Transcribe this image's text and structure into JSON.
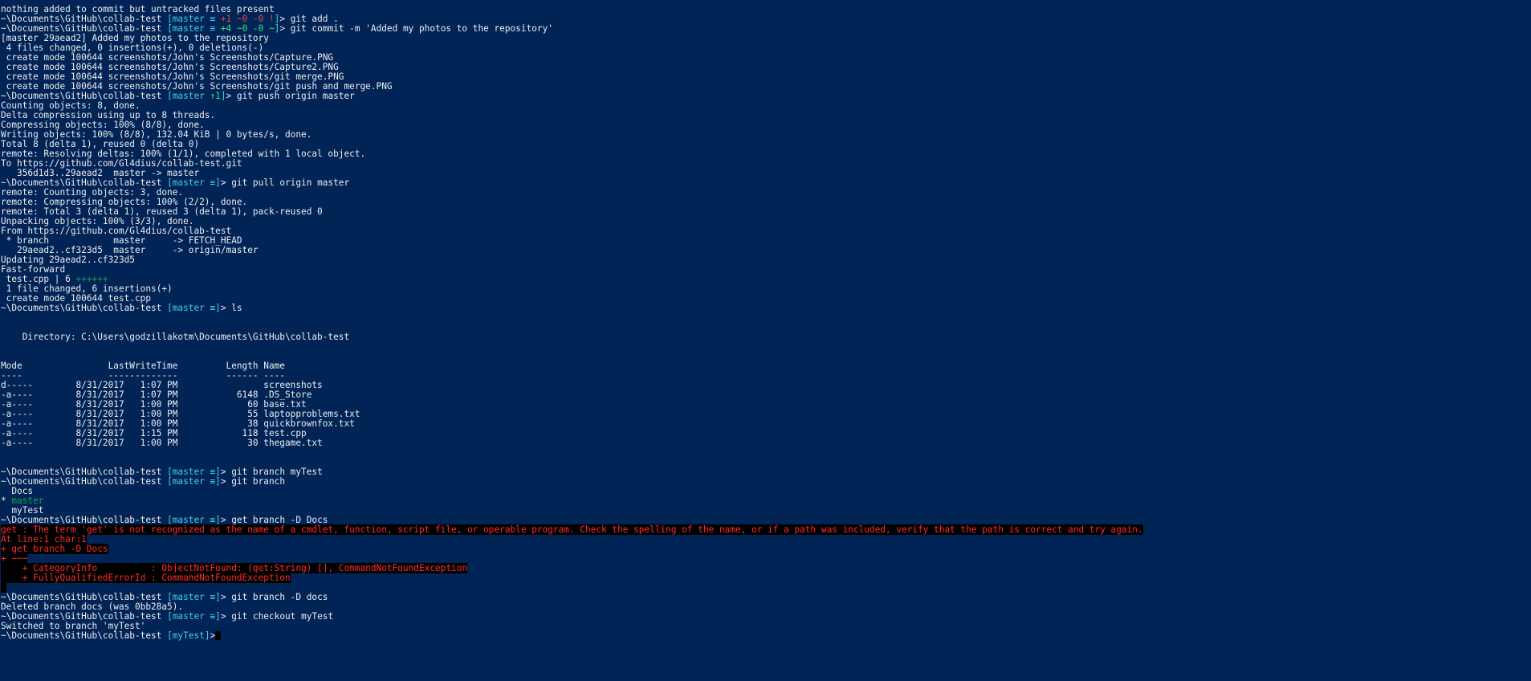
{
  "terminal": {
    "background": "#012456",
    "colors": {
      "default": "#eeedf0",
      "cyan": "#3fd1e6",
      "yellow": "#f5e94a",
      "red": "#e8484a",
      "green": "#3ee07a",
      "darkgreen": "#16a34a",
      "error_fg": "#ff2a2a",
      "error_bg": "#000000"
    },
    "lines": [
      {
        "segs": [
          {
            "t": "nothing added to commit but untracked files present"
          }
        ]
      },
      {
        "segs": [
          {
            "t": "~\\Documents\\GitHub\\collab-test "
          },
          {
            "t": "[master ",
            "c": "cyan"
          },
          {
            "t": "≡ ",
            "c": "cyan"
          },
          {
            "t": "+1 ~0 -0 !",
            "c": "red"
          },
          {
            "t": "]",
            "c": "cyan"
          },
          {
            "t": "> git add ."
          }
        ]
      },
      {
        "segs": [
          {
            "t": "~\\Documents\\GitHub\\collab-test "
          },
          {
            "t": "[master ",
            "c": "cyan"
          },
          {
            "t": "≡ ",
            "c": "cyan"
          },
          {
            "t": "+4 ~0 -0 ~",
            "c": "green"
          },
          {
            "t": "]",
            "c": "cyan"
          },
          {
            "t": "> git commit -m 'Added my photos to the repository'"
          }
        ]
      },
      {
        "segs": [
          {
            "t": "[master 29aead2] Added my photos to the repository"
          }
        ]
      },
      {
        "segs": [
          {
            "t": " 4 files changed, 0 insertions(+), 0 deletions(-)"
          }
        ]
      },
      {
        "segs": [
          {
            "t": " create mode 100644 screenshots/John's Screenshots/Capture.PNG"
          }
        ]
      },
      {
        "segs": [
          {
            "t": " create mode 100644 screenshots/John's Screenshots/Capture2.PNG"
          }
        ]
      },
      {
        "segs": [
          {
            "t": " create mode 100644 screenshots/John's Screenshots/git merge.PNG"
          }
        ]
      },
      {
        "segs": [
          {
            "t": " create mode 100644 screenshots/John's Screenshots/git push and merge.PNG"
          }
        ]
      },
      {
        "segs": [
          {
            "t": "~\\Documents\\GitHub\\collab-test "
          },
          {
            "t": "[master ",
            "c": "cyan"
          },
          {
            "t": "↑1",
            "c": "green"
          },
          {
            "t": "]",
            "c": "cyan"
          },
          {
            "t": "> git push origin master"
          }
        ]
      },
      {
        "segs": [
          {
            "t": "Counting objects: 8, done."
          }
        ]
      },
      {
        "segs": [
          {
            "t": "Delta compression using up to 8 threads."
          }
        ]
      },
      {
        "segs": [
          {
            "t": "Compressing objects: 100% (8/8), done."
          }
        ]
      },
      {
        "segs": [
          {
            "t": "Writing objects: 100% (8/8), 132.04 KiB | 0 bytes/s, done."
          }
        ]
      },
      {
        "segs": [
          {
            "t": "Total 8 (delta 1), reused 0 (delta 0)"
          }
        ]
      },
      {
        "segs": [
          {
            "t": "remote: Resolving deltas: 100% (1/1), completed with 1 local object."
          }
        ]
      },
      {
        "segs": [
          {
            "t": "To https://github.com/Gl4dius/collab-test.git"
          }
        ]
      },
      {
        "segs": [
          {
            "t": "   356d1d3..29aead2  master -> master"
          }
        ]
      },
      {
        "segs": [
          {
            "t": "~\\Documents\\GitHub\\collab-test "
          },
          {
            "t": "[master ≡]",
            "c": "cyan"
          },
          {
            "t": "> git pull origin master"
          }
        ]
      },
      {
        "segs": [
          {
            "t": "remote: Counting objects: 3, done."
          }
        ]
      },
      {
        "segs": [
          {
            "t": "remote: Compressing objects: 100% (2/2), done."
          }
        ]
      },
      {
        "segs": [
          {
            "t": "remote: Total 3 (delta 1), reused 3 (delta 1), pack-reused 0"
          }
        ]
      },
      {
        "segs": [
          {
            "t": "Unpacking objects: 100% (3/3), done."
          }
        ]
      },
      {
        "segs": [
          {
            "t": "From https://github.com/Gl4dius/collab-test"
          }
        ]
      },
      {
        "segs": [
          {
            "t": " * branch            master     -> FETCH_HEAD"
          }
        ]
      },
      {
        "segs": [
          {
            "t": "   29aead2..cf323d5  master     -> origin/master"
          }
        ]
      },
      {
        "segs": [
          {
            "t": "Updating 29aead2..cf323d5"
          }
        ]
      },
      {
        "segs": [
          {
            "t": "Fast-forward"
          }
        ]
      },
      {
        "segs": [
          {
            "t": " test.cpp | 6 "
          },
          {
            "t": "++++++",
            "c": "darkgreen"
          }
        ]
      },
      {
        "segs": [
          {
            "t": " 1 file changed, 6 insertions(+)"
          }
        ]
      },
      {
        "segs": [
          {
            "t": " create mode 100644 test.cpp"
          }
        ]
      },
      {
        "segs": [
          {
            "t": "~\\Documents\\GitHub\\collab-test "
          },
          {
            "t": "[master ≡]",
            "c": "cyan"
          },
          {
            "t": "> ls"
          }
        ]
      },
      {
        "segs": [
          {
            "t": ""
          }
        ]
      },
      {
        "segs": [
          {
            "t": ""
          }
        ]
      },
      {
        "segs": [
          {
            "t": "    Directory: C:\\Users\\godzillakotm\\Documents\\GitHub\\collab-test"
          }
        ]
      },
      {
        "segs": [
          {
            "t": ""
          }
        ]
      },
      {
        "segs": [
          {
            "t": ""
          }
        ]
      },
      {
        "segs": [
          {
            "t": "Mode                LastWriteTime         Length Name"
          }
        ]
      },
      {
        "segs": [
          {
            "t": "----                -------------         ------ ----"
          }
        ]
      },
      {
        "segs": [
          {
            "t": "d-----        8/31/2017   1:07 PM                screenshots"
          }
        ]
      },
      {
        "segs": [
          {
            "t": "-a----        8/31/2017   1:07 PM           6148 .DS_Store"
          }
        ]
      },
      {
        "segs": [
          {
            "t": "-a----        8/31/2017   1:00 PM             60 base.txt"
          }
        ]
      },
      {
        "segs": [
          {
            "t": "-a----        8/31/2017   1:00 PM             55 laptopproblems.txt"
          }
        ]
      },
      {
        "segs": [
          {
            "t": "-a----        8/31/2017   1:00 PM             38 quickbrownfox.txt"
          }
        ]
      },
      {
        "segs": [
          {
            "t": "-a----        8/31/2017   1:15 PM            118 test.cpp"
          }
        ]
      },
      {
        "segs": [
          {
            "t": "-a----        8/31/2017   1:00 PM             30 thegame.txt"
          }
        ]
      },
      {
        "segs": [
          {
            "t": ""
          }
        ]
      },
      {
        "segs": [
          {
            "t": ""
          }
        ]
      },
      {
        "segs": [
          {
            "t": "~\\Documents\\GitHub\\collab-test "
          },
          {
            "t": "[master ≡]",
            "c": "cyan"
          },
          {
            "t": "> git branch myTest"
          }
        ]
      },
      {
        "segs": [
          {
            "t": "~\\Documents\\GitHub\\collab-test "
          },
          {
            "t": "[master ≡]",
            "c": "cyan"
          },
          {
            "t": "> git branch"
          }
        ]
      },
      {
        "segs": [
          {
            "t": "  Docs"
          }
        ]
      },
      {
        "segs": [
          {
            "t": "* "
          },
          {
            "t": "master",
            "c": "darkgreen"
          }
        ]
      },
      {
        "segs": [
          {
            "t": "  myTest"
          }
        ]
      },
      {
        "segs": [
          {
            "t": "~\\Documents\\GitHub\\collab-test "
          },
          {
            "t": "[master ≡]",
            "c": "cyan"
          },
          {
            "t": "> get branch -D Docs"
          }
        ]
      },
      {
        "segs": [
          {
            "t": "get : The term 'get' is not recognized as the name of a cmdlet, function, script file, or operable program. Check the spelling of the name, or if a path was included, verify that the path is correct and try again.",
            "c": "err"
          }
        ]
      },
      {
        "segs": [
          {
            "t": "At line:1 char:1",
            "c": "err"
          }
        ]
      },
      {
        "segs": [
          {
            "t": "+ get branch -D Docs",
            "c": "err"
          }
        ]
      },
      {
        "segs": [
          {
            "t": "+ ~~~",
            "c": "err"
          }
        ]
      },
      {
        "segs": [
          {
            "t": "    + CategoryInfo          : ObjectNotFound: (get:String) [], CommandNotFoundException",
            "c": "err"
          }
        ]
      },
      {
        "segs": [
          {
            "t": "    + FullyQualifiedErrorId : CommandNotFoundException",
            "c": "err"
          }
        ]
      },
      {
        "segs": [
          {
            "t": " ",
            "c": "err"
          }
        ]
      },
      {
        "segs": [
          {
            "t": "~\\Documents\\GitHub\\collab-test "
          },
          {
            "t": "[master ≡]",
            "c": "cyan"
          },
          {
            "t": "> git branch -D docs"
          }
        ]
      },
      {
        "segs": [
          {
            "t": "Deleted branch docs (was 0bb28a5)."
          }
        ]
      },
      {
        "segs": [
          {
            "t": "~\\Documents\\GitHub\\collab-test "
          },
          {
            "t": "[master ≡]",
            "c": "cyan"
          },
          {
            "t": "> git checkout myTest"
          }
        ]
      },
      {
        "segs": [
          {
            "t": "Switched to branch 'myTest'"
          }
        ]
      },
      {
        "segs": [
          {
            "t": "~\\Documents\\GitHub\\collab-test "
          },
          {
            "t": "[myTest]",
            "c": "cyan"
          },
          {
            "t": ">"
          }
        ]
      }
    ]
  }
}
